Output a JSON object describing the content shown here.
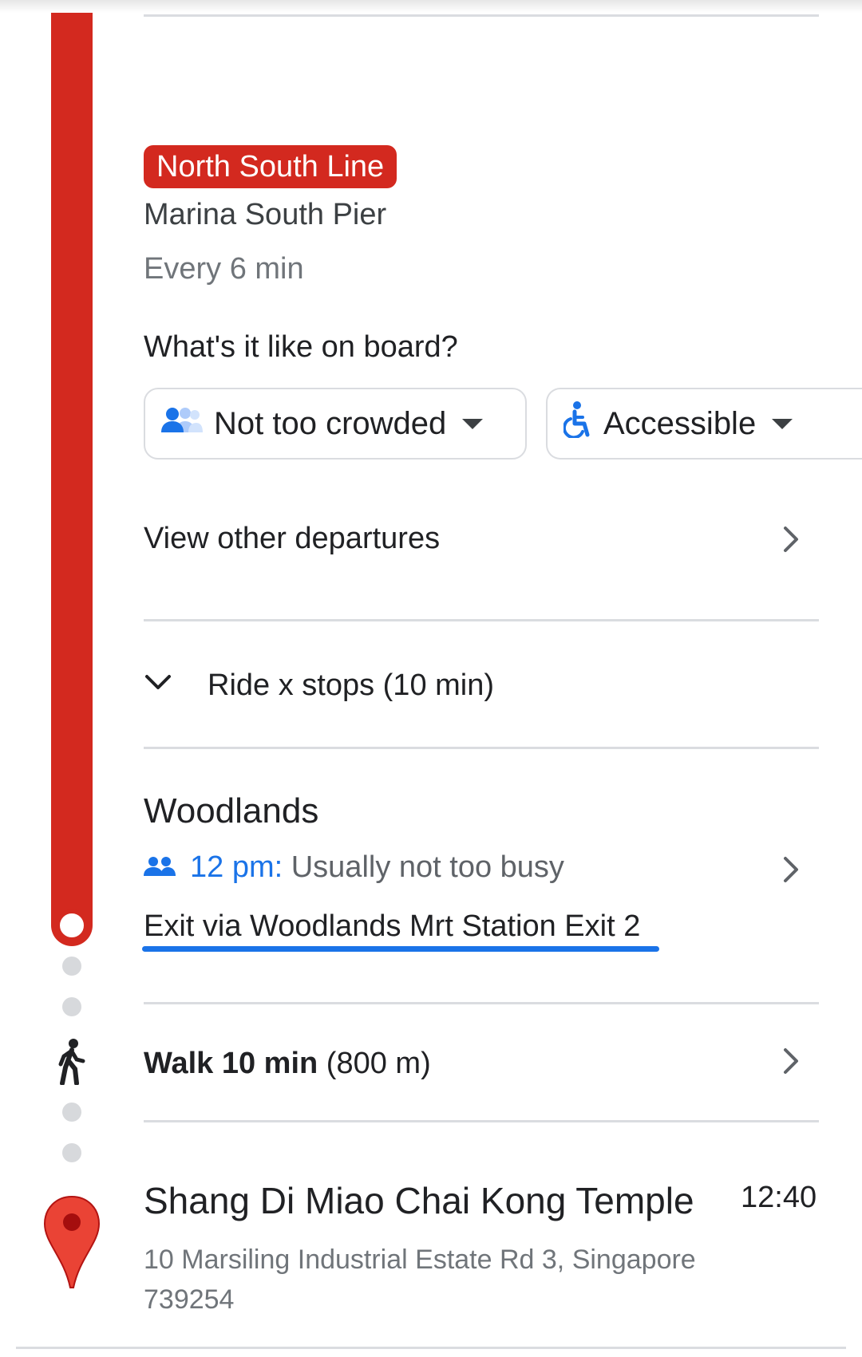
{
  "colors": {
    "line": "#d3291f",
    "accent_blue": "#1a73e8",
    "muted_text": "#70757a",
    "divider": "#dadce0",
    "dot": "#d7d9dc"
  },
  "transit": {
    "line_name": "North South Line",
    "headsign": "Marina South Pier",
    "frequency": "Every 6 min",
    "onboard_question": "What's it like on board?",
    "crowd_chip": {
      "icon": "people-icon",
      "label": "Not too crowded"
    },
    "accessible_chip": {
      "icon": "wheelchair-icon",
      "label": "Accessible"
    },
    "view_departures": "View other departures",
    "ride_stops": "Ride x stops (10 min)"
  },
  "arrival": {
    "station": "Woodlands",
    "busy_time": "12 pm:",
    "busy_desc": "Usually not too busy",
    "exit": "Exit via Woodlands Mrt Station Exit 2"
  },
  "walk": {
    "duration": "Walk 10 min",
    "distance": "(800 m)"
  },
  "destination": {
    "name": "Shang Di Miao Chai Kong Temple",
    "time": "12:40",
    "address": "10 Marsiling Industrial Estate Rd 3, Singapore 739254"
  }
}
